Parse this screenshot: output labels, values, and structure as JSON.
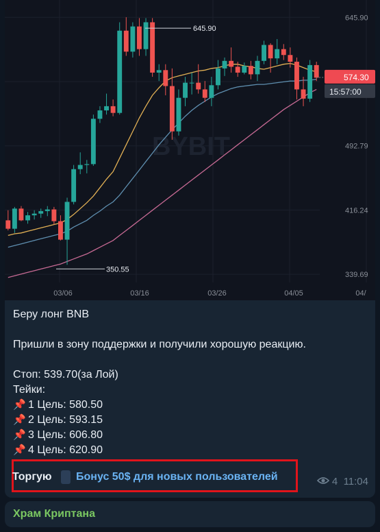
{
  "chart_data": {
    "type": "candlestick",
    "exchange_watermark": "BYBIT",
    "x_tick_labels": [
      "03/06",
      "03/16",
      "03/26",
      "04/05",
      "04/"
    ],
    "y_tick_labels": [
      "645.90",
      "492.79",
      "416.24",
      "339.69"
    ],
    "last_price_label": "574.30",
    "countdown_label": "15:57:00",
    "high_annotation": "645.90",
    "low_annotation": "350.55",
    "ylim": [
      330,
      660
    ],
    "candles": [
      [
        404,
        416,
        392,
        394
      ],
      [
        394,
        420,
        389,
        418
      ],
      [
        418,
        421,
        403,
        404
      ],
      [
        404,
        414,
        400,
        410
      ],
      [
        410,
        416,
        405,
        412
      ],
      [
        412,
        418,
        407,
        415
      ],
      [
        415,
        421,
        409,
        417
      ],
      [
        417,
        420,
        399,
        403
      ],
      [
        403,
        410,
        380,
        381
      ],
      [
        381,
        431,
        351,
        426
      ],
      [
        426,
        470,
        423,
        465
      ],
      [
        465,
        485,
        459,
        470
      ],
      [
        470,
        476,
        460,
        471
      ],
      [
        471,
        530,
        469,
        525
      ],
      [
        525,
        540,
        520,
        535
      ],
      [
        535,
        555,
        530,
        540
      ],
      [
        540,
        548,
        528,
        532
      ],
      [
        532,
        640,
        530,
        630
      ],
      [
        630,
        646,
        600,
        605
      ],
      [
        605,
        640,
        598,
        635
      ],
      [
        635,
        645,
        600,
        608
      ],
      [
        608,
        645,
        600,
        640
      ],
      [
        640,
        645,
        575,
        580
      ],
      [
        580,
        590,
        570,
        583
      ],
      [
        583,
        590,
        553,
        564
      ],
      [
        564,
        585,
        500,
        510
      ],
      [
        510,
        560,
        505,
        550
      ],
      [
        550,
        575,
        540,
        568
      ],
      [
        568,
        580,
        554,
        568
      ],
      [
        568,
        590,
        555,
        560
      ],
      [
        560,
        570,
        545,
        550
      ],
      [
        550,
        575,
        540,
        565
      ],
      [
        565,
        595,
        560,
        585
      ],
      [
        585,
        598,
        576,
        594
      ],
      [
        594,
        610,
        580,
        587
      ],
      [
        587,
        593,
        575,
        580
      ],
      [
        580,
        592,
        578,
        588
      ],
      [
        588,
        594,
        572,
        578
      ],
      [
        578,
        600,
        570,
        594
      ],
      [
        594,
        618,
        590,
        613
      ],
      [
        613,
        615,
        580,
        597
      ],
      [
        597,
        620,
        590,
        608
      ],
      [
        608,
        614,
        595,
        601
      ],
      [
        601,
        610,
        586,
        593
      ],
      [
        593,
        598,
        548,
        560
      ],
      [
        560,
        575,
        540,
        549
      ],
      [
        549,
        595,
        545,
        589
      ],
      [
        589,
        593,
        570,
        574
      ]
    ],
    "ma_series": [
      {
        "color": "#e3b155",
        "values": [
          386,
          388,
          389,
          391,
          393,
          395,
          397,
          399,
          401,
          405,
          411,
          418,
          425,
          433,
          443,
          453,
          462,
          478,
          494,
          510,
          526,
          540,
          553,
          562,
          570,
          574,
          576,
          578,
          580,
          582,
          583,
          585,
          586,
          588,
          590,
          590,
          588,
          587,
          585,
          584,
          586,
          588,
          590,
          591,
          589,
          586,
          583,
          581
        ]
      },
      {
        "color": "#5f8fb0",
        "values": [
          372,
          374,
          376,
          378,
          380,
          382,
          384,
          386,
          388,
          391,
          396,
          400,
          404,
          410,
          415,
          421,
          426,
          434,
          444,
          454,
          464,
          474,
          484,
          494,
          503,
          512,
          520,
          528,
          535,
          541,
          546,
          551,
          555,
          558,
          561,
          563,
          564,
          565,
          566,
          566,
          567,
          568,
          569,
          570,
          570,
          571,
          571,
          572
        ]
      },
      {
        "color": "#c76a94",
        "values": [
          336,
          338,
          340,
          342,
          344,
          346,
          348,
          350,
          352,
          355,
          358,
          361,
          364,
          368,
          372,
          376,
          380,
          386,
          392,
          398,
          404,
          410,
          416,
          422,
          428,
          434,
          440,
          446,
          452,
          458,
          464,
          470,
          476,
          482,
          488,
          494,
          500,
          506,
          512,
          518,
          524,
          530,
          536,
          541,
          546,
          551,
          556,
          560
        ]
      }
    ]
  },
  "post": {
    "line1": "Беру лонг BNB",
    "line2": "Пришли в зону поддержки и получили хорошую реакцию.",
    "stop": "Стоп: 539.70(за Лой)",
    "targets_title": "Тейки:",
    "pin_glyph": "📌",
    "targets": [
      "1 Цель: 580.50",
      "2 Цель: 593.15",
      "3 Цель: 606.80",
      "4 Цель: 620.90"
    ],
    "promo_label": "Торгую",
    "promo_link": "Бонус 50$ для новых пользователей",
    "views": "4",
    "time": "11:04"
  },
  "channel": {
    "name": "Храм Криптана"
  },
  "colors": {
    "up": "#26a69a",
    "down": "#ef5350",
    "link": "#6ab3f3",
    "highlight": "#e0141b",
    "channel": "#7bc862"
  }
}
